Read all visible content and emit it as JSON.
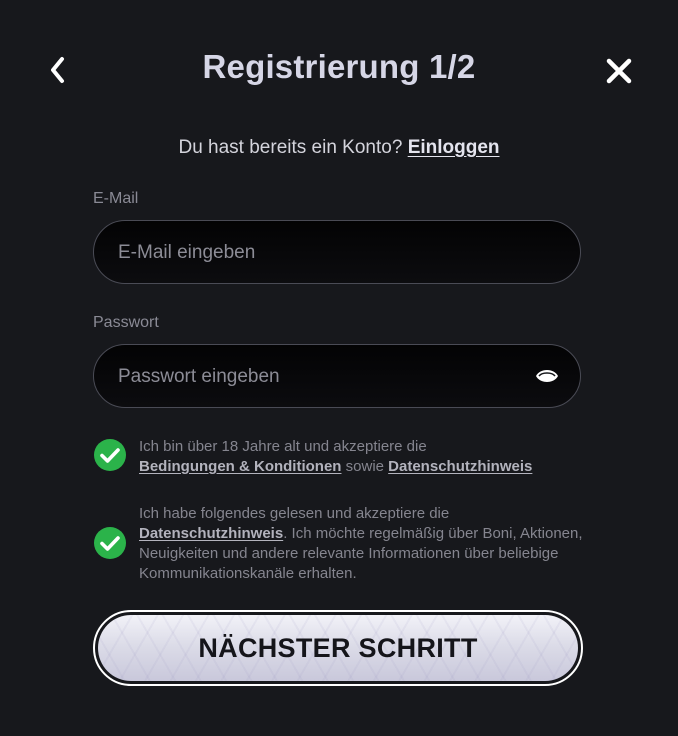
{
  "header": {
    "title": "Registrierung 1/2",
    "back_icon": "chevron-left-icon",
    "close_icon": "close-icon"
  },
  "login_prompt": {
    "text": "Du hast bereits ein Konto?",
    "link_label": "Einloggen"
  },
  "email": {
    "label": "E-Mail",
    "placeholder": "E-Mail eingeben",
    "value": ""
  },
  "password": {
    "label": "Passwort",
    "placeholder": "Passwort eingeben",
    "value": "",
    "toggle_icon": "eye-icon"
  },
  "consents": [
    {
      "checked": true,
      "text_before": "Ich bin über 18 Jahre alt und akzeptiere die",
      "link1": "Bedingungen & Konditionen",
      "middle": " sowie ",
      "link2": "Datenschutzhinweis"
    },
    {
      "checked": true,
      "text_before": "Ich habe folgendes gelesen und akzeptiere die",
      "link1": "Datenschutzhinweis",
      "text_after": ". Ich möchte regelmäßig über Boni, Aktionen, Neuigkeiten und andere relevante Informationen über beliebige Kommunikationskanäle erhalten."
    }
  ],
  "next_button": {
    "label": "NÄCHSTER SCHRITT"
  },
  "colors": {
    "background": "#17181c",
    "check_green": "#2bb34a",
    "title_text": "#d6d6e6",
    "button_bg": "#e4e4ee"
  }
}
